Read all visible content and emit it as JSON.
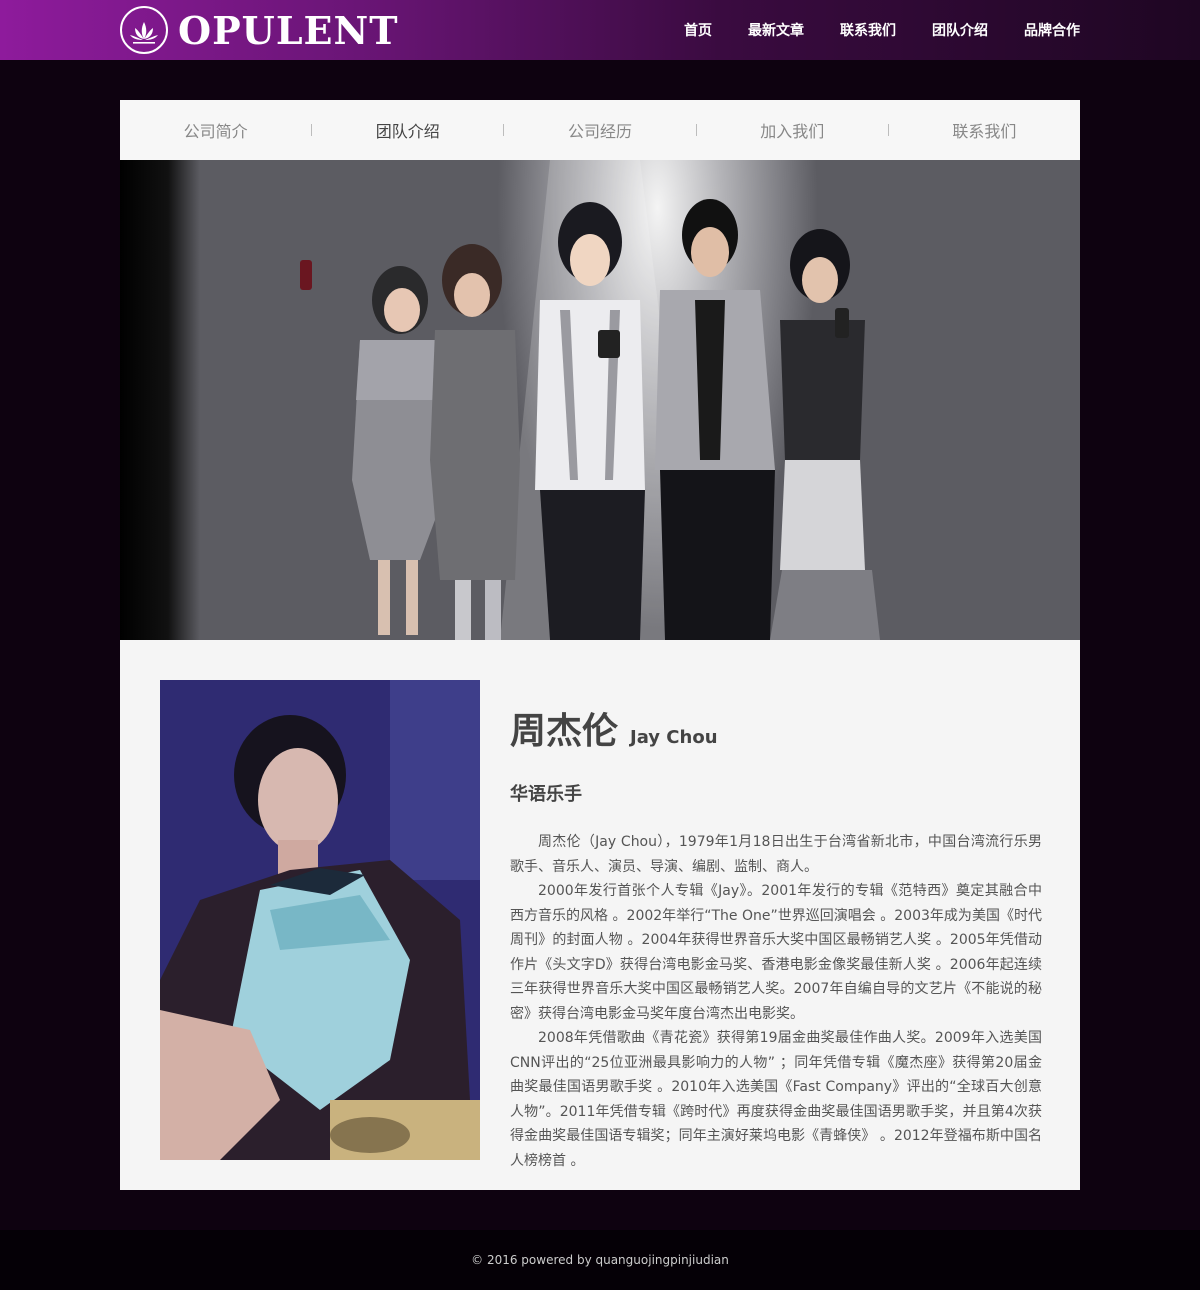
{
  "header": {
    "logo_text": "OPULENT",
    "nav": [
      {
        "label": "首页"
      },
      {
        "label": "最新文章"
      },
      {
        "label": "联系我们"
      },
      {
        "label": "团队介绍"
      },
      {
        "label": "品牌合作"
      }
    ]
  },
  "subnav": {
    "items": [
      {
        "label": "公司简介"
      },
      {
        "label": "团队介绍"
      },
      {
        "label": "公司经历"
      },
      {
        "label": "加入我们"
      },
      {
        "label": "联系我们"
      }
    ],
    "active": "团队介绍"
  },
  "profile": {
    "name_cn": "周杰伦",
    "name_en": "Jay Chou",
    "role": "华语乐手",
    "bio": [
      "周杰伦（Jay Chou），1979年1月18日出生于台湾省新北市，中国台湾流行乐男歌手、音乐人、演员、导演、编剧、监制、商人。",
      "2000年发行首张个人专辑《Jay》。2001年发行的专辑《范特西》奠定其融合中西方音乐的风格 。2002年举行“The One”世界巡回演唱会 。2003年成为美国《时代周刊》的封面人物 。2004年获得世界音乐大奖中国区最畅销艺人奖 。2005年凭借动作片《头文字D》获得台湾电影金马奖、香港电影金像奖最佳新人奖 。2006年起连续三年获得世界音乐大奖中国区最畅销艺人奖。2007年自编自导的文艺片《不能说的秘密》获得台湾电影金马奖年度台湾杰出电影奖。",
      "2008年凭借歌曲《青花瓷》获得第19届金曲奖最佳作曲人奖。2009年入选美国CNN评出的“25位亚洲最具影响力的人物” ；同年凭借专辑《魔杰座》获得第20届金曲奖最佳国语男歌手奖 。2010年入选美国《Fast Company》评出的“全球百大创意人物”。2011年凭借专辑《跨时代》再度获得金曲奖最佳国语男歌手奖，并且第4次获得金曲奖最佳国语专辑奖；同年主演好莱坞电影《青蜂侠》 。2012年登福布斯中国名人榜榜首 。"
    ]
  },
  "footer": {
    "copyright": "© 2016 powered by quanguojingpinjiudian"
  },
  "colors": {
    "header_start": "#8e1b9c",
    "header_end": "#1e0622",
    "page_bg": "#0e0210",
    "panel_bg": "#f5f5f5",
    "text_dark": "#444444"
  },
  "icons": [
    "lotus-logo-icon"
  ]
}
